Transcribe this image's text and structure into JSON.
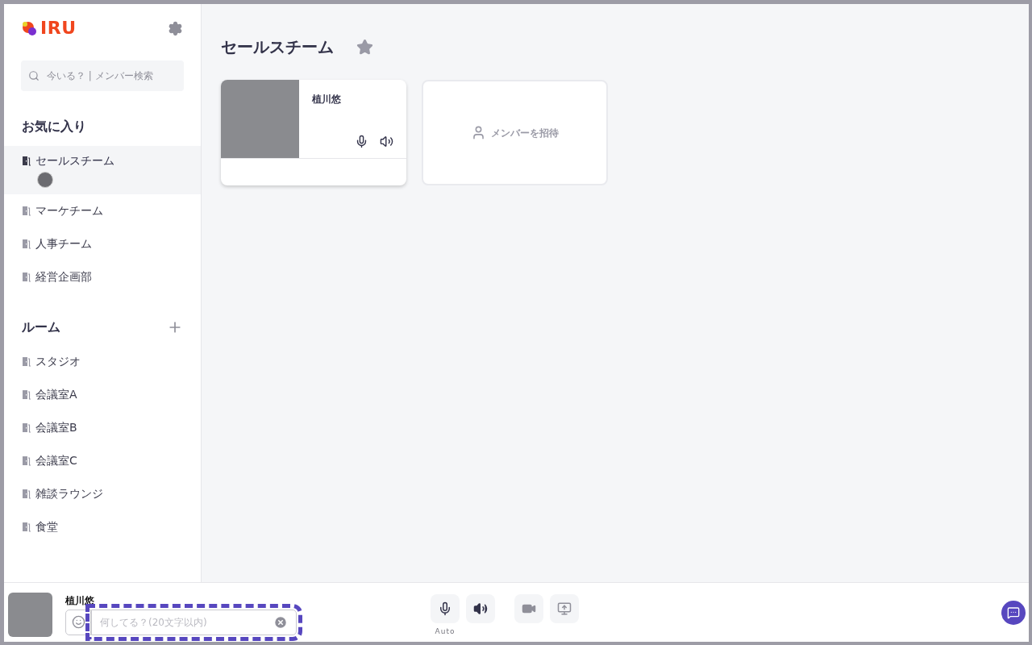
{
  "sidebar": {
    "logo": "IRU",
    "search": {
      "placeholder": "今いる？ | メンバー検索"
    },
    "favorites": {
      "title": "お気に入り",
      "items": [
        {
          "label": "セールスチーム",
          "selected": true,
          "members": [
            {
              "kind": "avatar"
            }
          ]
        },
        {
          "label": "マーケチーム",
          "selected": false
        },
        {
          "label": "人事チーム",
          "selected": false
        },
        {
          "label": "経営企画部",
          "selected": false
        }
      ]
    },
    "rooms": {
      "title": "ルーム",
      "items": [
        {
          "label": "スタジオ",
          "selected": false
        },
        {
          "label": "会議室A",
          "selected": false
        },
        {
          "label": "会議室B",
          "selected": false
        },
        {
          "label": "会議室C",
          "selected": false
        },
        {
          "label": "雑談ラウンジ",
          "selected": false
        },
        {
          "label": "食堂",
          "selected": false
        }
      ]
    }
  },
  "main": {
    "title": "セールスチーム",
    "member_cards": [
      {
        "name": "植川悠"
      }
    ],
    "invite_label": "メンバーを招待"
  },
  "bottom_bar": {
    "user_name": "植川悠",
    "status": {
      "placeholder": "何してる？(20文字以内)"
    },
    "mic_mode": "Auto"
  }
}
